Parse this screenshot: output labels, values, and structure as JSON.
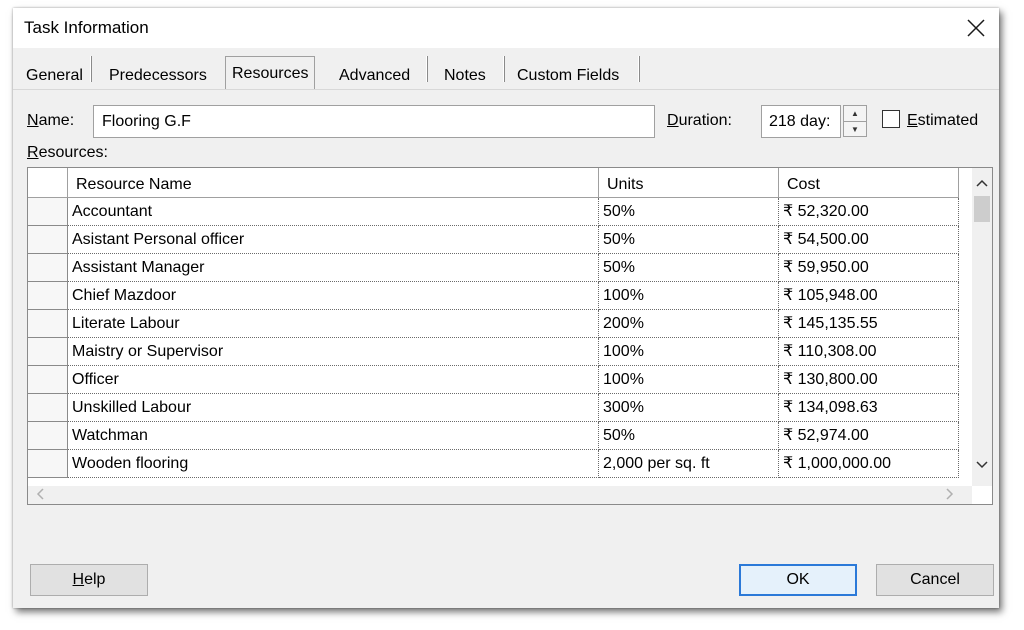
{
  "dialog": {
    "title": "Task Information",
    "close_icon": "close-icon"
  },
  "tabs": [
    {
      "label": "General",
      "active": false
    },
    {
      "label": "Predecessors",
      "active": false
    },
    {
      "label": "Resources",
      "active": true
    },
    {
      "label": "Advanced",
      "active": false
    },
    {
      "label": "Notes",
      "active": false
    },
    {
      "label": "Custom Fields",
      "active": false
    }
  ],
  "form": {
    "name_label_ul": "N",
    "name_label_rest": "ame:",
    "name_value": "Flooring G.F",
    "duration_label_ul": "D",
    "duration_label_rest": "uration:",
    "duration_value": "218 day:",
    "estimated_label_ul": "E",
    "estimated_label_rest": "stimated",
    "estimated_checked": false,
    "resources_label_ul": "R",
    "resources_label_rest": "esources:"
  },
  "resources_table": {
    "columns": [
      "Resource Name",
      "Units",
      "Cost"
    ],
    "rows": [
      {
        "name": "Accountant",
        "units": "50%",
        "cost": "₹ 52,320.00"
      },
      {
        "name": "Asistant Personal officer",
        "units": "50%",
        "cost": "₹ 54,500.00"
      },
      {
        "name": "Assistant Manager",
        "units": "50%",
        "cost": "₹ 59,950.00"
      },
      {
        "name": "Chief Mazdoor",
        "units": "100%",
        "cost": "₹ 105,948.00"
      },
      {
        "name": "Literate Labour",
        "units": "200%",
        "cost": "₹ 145,135.55"
      },
      {
        "name": "Maistry or Supervisor",
        "units": "100%",
        "cost": "₹ 110,308.00"
      },
      {
        "name": "Officer",
        "units": "100%",
        "cost": "₹ 130,800.00"
      },
      {
        "name": "Unskilled Labour",
        "units": "300%",
        "cost": "₹ 134,098.63"
      },
      {
        "name": "Watchman",
        "units": "50%",
        "cost": "₹ 52,974.00"
      },
      {
        "name": "Wooden flooring",
        "units": "2,000 per sq. ft",
        "cost": "₹ 1,000,000.00"
      }
    ]
  },
  "buttons": {
    "help_ul": "H",
    "help_rest": "elp",
    "ok": "OK",
    "cancel": "Cancel"
  },
  "icons": {
    "spin_up": "spin-up-icon",
    "spin_down": "spin-down-icon",
    "scroll_up": "chevron-up-icon",
    "scroll_down": "chevron-down-icon",
    "scroll_left": "chevron-left-icon",
    "scroll_right": "chevron-right-icon"
  }
}
